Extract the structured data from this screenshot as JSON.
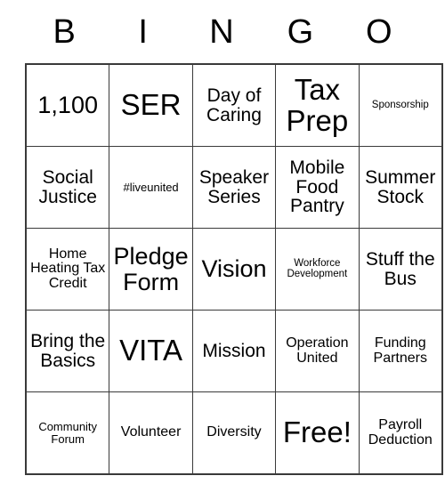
{
  "card": {
    "title": "Bingo Card",
    "headers": [
      "B",
      "I",
      "N",
      "G",
      "O"
    ],
    "rows": [
      [
        {
          "label": "1,100",
          "size": "sz-lg"
        },
        {
          "label": "SER",
          "size": "sz-xl"
        },
        {
          "label": "Day of Caring",
          "size": "sz-md"
        },
        {
          "label": "Tax Prep",
          "size": "sz-xl"
        },
        {
          "label": "Sponsorship",
          "size": "sz-xxs"
        }
      ],
      [
        {
          "label": "Social Justice",
          "size": "sz-md"
        },
        {
          "label": "#liveunited",
          "size": "sz-xs"
        },
        {
          "label": "Speaker Series",
          "size": "sz-md"
        },
        {
          "label": "Mobile Food Pantry",
          "size": "sz-md"
        },
        {
          "label": "Summer Stock",
          "size": "sz-md"
        }
      ],
      [
        {
          "label": "Home Heating Tax Credit",
          "size": "sz-sm"
        },
        {
          "label": "Pledge Form",
          "size": "sz-lg"
        },
        {
          "label": "Vision",
          "size": "sz-lg"
        },
        {
          "label": "Workforce Development",
          "size": "sz-xxs"
        },
        {
          "label": "Stuff the Bus",
          "size": "sz-md"
        }
      ],
      [
        {
          "label": "Bring the Basics",
          "size": "sz-md"
        },
        {
          "label": "VITA",
          "size": "sz-xl"
        },
        {
          "label": "Mission",
          "size": "sz-md"
        },
        {
          "label": "Operation United",
          "size": "sz-sm"
        },
        {
          "label": "Funding Partners",
          "size": "sz-sm"
        }
      ],
      [
        {
          "label": "Community Forum",
          "size": "sz-xs"
        },
        {
          "label": "Volunteer",
          "size": "sz-sm"
        },
        {
          "label": "Diversity",
          "size": "sz-sm"
        },
        {
          "label": "Free!",
          "size": "sz-xl"
        },
        {
          "label": "Payroll Deduction",
          "size": "sz-sm"
        }
      ]
    ],
    "colors": {
      "border": "#3a3a3a",
      "text": "#000000",
      "background": "#ffffff"
    }
  }
}
